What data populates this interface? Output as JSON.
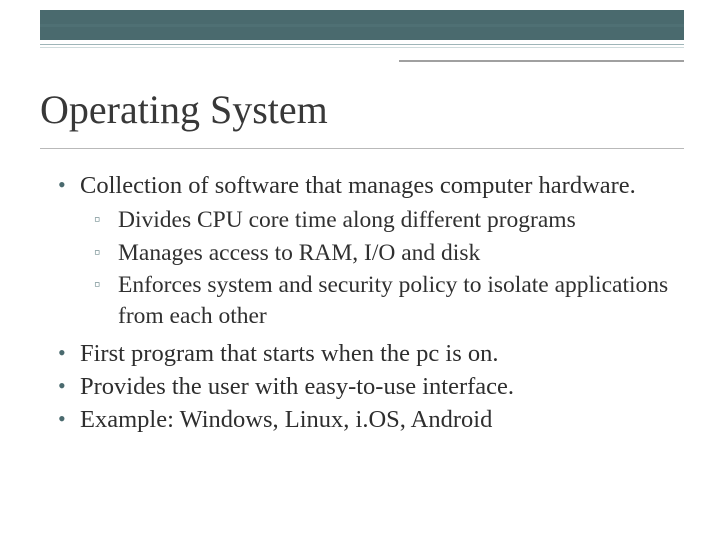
{
  "title": "Operating System",
  "bullets": {
    "b0": "Collection of software that manages computer hardware.",
    "b0_sub": {
      "s0": "Divides CPU core time along different programs",
      "s1": "Manages access to RAM, I/O and disk",
      "s2": "Enforces system and security policy to isolate applications from each other"
    },
    "b1": "First program that starts when the pc is on.",
    "b2": "Provides the user with easy-to-use interface.",
    "b3": "Example: Windows, Linux, i.OS, Android"
  }
}
